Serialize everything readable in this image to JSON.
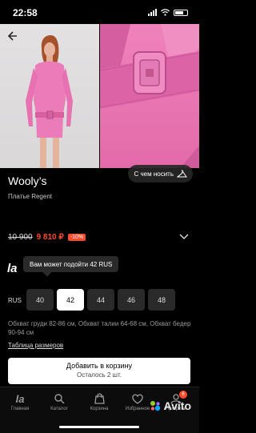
{
  "status_bar": {
    "time": "22:58"
  },
  "hero": {
    "try_on_label": "С чем носить"
  },
  "product": {
    "brand": "Wooly’s",
    "name": "Платье Regent",
    "old_price": "10 900",
    "new_price": "9 810 ₽",
    "discount": "-10%"
  },
  "sizes": {
    "logo_text": "la",
    "tooltip": "Вам может подойти 42 RUS",
    "system_label": "RUS",
    "options": [
      "40",
      "42",
      "44",
      "46",
      "48"
    ],
    "selected": "42",
    "measurements": "Обхват груди 82-86 см, Обхват талии 64-68 см, Обхват бедер 90-94 см",
    "size_table_link": "Таблица размеров"
  },
  "cart": {
    "add_label": "Добавить в корзину",
    "stock_label": "Осталось 2 шт."
  },
  "tab_bar": {
    "items": [
      {
        "label": "Главная",
        "icon": "la-logo-icon"
      },
      {
        "label": "Каталог",
        "icon": "catalog-icon"
      },
      {
        "label": "Корзина",
        "icon": "bag-icon"
      },
      {
        "label": "Избранное",
        "icon": "heart-icon"
      },
      {
        "label": "Профиль",
        "icon": "profile-icon",
        "badge": "6"
      }
    ],
    "watermark": "Avito"
  },
  "colors": {
    "accent": "#ff4a2b",
    "dress_pink": "#e874b3",
    "background": "#000000"
  }
}
